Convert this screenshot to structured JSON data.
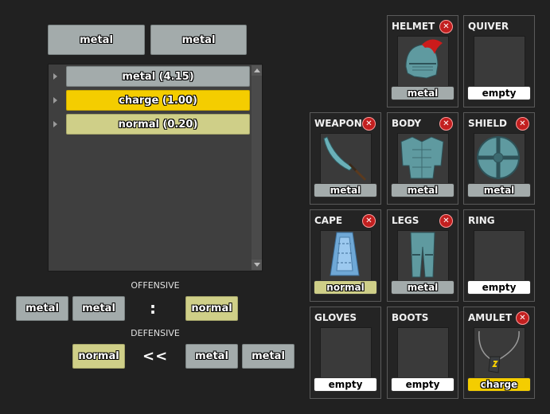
{
  "top_buttons": [
    "metal",
    "metal"
  ],
  "type_list": [
    {
      "label": "metal (4.15)",
      "kind": "metal"
    },
    {
      "label": "charge (1.00)",
      "kind": "charge"
    },
    {
      "label": "normal (0.20)",
      "kind": "normal"
    }
  ],
  "offensive": {
    "heading": "OFFENSIVE",
    "left": [
      "metal",
      "metal"
    ],
    "separator": ":",
    "right": [
      "normal"
    ]
  },
  "defensive": {
    "heading": "DEFENSIVE",
    "left": [
      "normal"
    ],
    "separator": "<<",
    "right": [
      "metal",
      "metal"
    ]
  },
  "equipment": {
    "helmet": {
      "title": "HELMET",
      "tag": "metal",
      "kind": "metal",
      "icon": "helmet-icon"
    },
    "quiver": {
      "title": "QUIVER",
      "tag": "empty",
      "kind": "empty"
    },
    "weapon": {
      "title": "WEAPON",
      "tag": "metal",
      "kind": "metal",
      "icon": "sword-icon"
    },
    "body": {
      "title": "BODY",
      "tag": "metal",
      "kind": "metal",
      "icon": "body-armor-icon"
    },
    "shield": {
      "title": "SHIELD",
      "tag": "metal",
      "kind": "metal",
      "icon": "shield-icon"
    },
    "cape": {
      "title": "CAPE",
      "tag": "normal",
      "kind": "normal",
      "icon": "cape-icon"
    },
    "legs": {
      "title": "LEGS",
      "tag": "metal",
      "kind": "metal",
      "icon": "leg-armor-icon"
    },
    "ring": {
      "title": "RING",
      "tag": "empty",
      "kind": "empty"
    },
    "gloves": {
      "title": "GLOVES",
      "tag": "empty",
      "kind": "empty"
    },
    "boots": {
      "title": "BOOTS",
      "tag": "empty",
      "kind": "empty"
    },
    "amulet": {
      "title": "AMULET",
      "tag": "charge",
      "kind": "charge",
      "icon": "amulet-icon"
    }
  },
  "remove_glyph": "✕"
}
